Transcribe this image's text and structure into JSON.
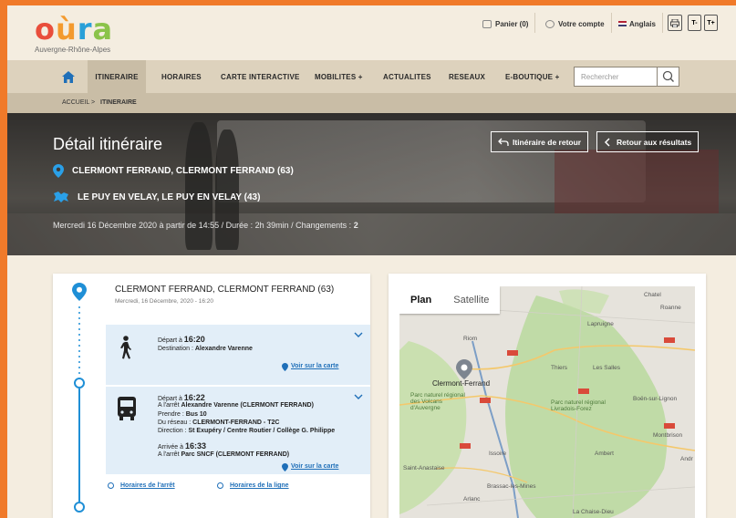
{
  "logo": {
    "letters": [
      "o",
      "ù",
      "r",
      "a"
    ],
    "subtitle": "Auvergne-Rhône-Alpes"
  },
  "utility": {
    "cart": "Panier (0)",
    "account": "Votre compte",
    "language": "Anglais",
    "font_small": "T-",
    "font_large": "T+",
    "icons": [
      "cart-icon",
      "user-icon",
      "flag-uk-icon",
      "print-icon"
    ]
  },
  "nav": {
    "items": [
      "ITINERAIRE",
      "HORAIRES",
      "CARTE INTERACTIVE",
      "MOBILITES +",
      "ACTUALITES",
      "RESEAUX",
      "E-BOUTIQUE +"
    ],
    "active": "ITINERAIRE",
    "search_placeholder": "Rechercher"
  },
  "breadcrumb": {
    "home": "ACCUEIL",
    "separator": ">",
    "current": "ITINERAIRE"
  },
  "hero": {
    "title": "Détail itinéraire",
    "origin": "CLERMONT FERRAND, CLERMONT FERRAND (63)",
    "destination": "LE PUY EN VELAY, LE PUY EN VELAY (43)",
    "meta_prefix": "Mercredi 16 Décembre 2020 à partir de 14:55 / Durée : 2h 39min / Changements : ",
    "changes": "2",
    "return_button": "Itinéraire de retour",
    "back_button": "Retour aux résultats"
  },
  "itinerary": {
    "origin_title": "CLERMONT FERRAND, CLERMONT FERRAND (63)",
    "origin_date": "Mercredi, 16 Décembre, 2020 - 16:20",
    "walk": {
      "depart_label": "Départ à ",
      "depart_time": "16:20",
      "destination_label": "Destination : ",
      "destination": "Alexandre Varenne",
      "map_link": "Voir sur la carte"
    },
    "bus": {
      "depart_label": "Départ à ",
      "depart_time": "16:22",
      "stop_label": "A l'arrêt ",
      "stop": "Alexandre Varenne (CLERMONT FERRAND)",
      "take_label": "Prendre : ",
      "line": "Bus 10",
      "network_label": "Du réseau : ",
      "network": "CLERMONT-FERRAND - T2C",
      "direction_label": "Direction : ",
      "direction": "St Exupéry / Centre Routier / Collège G. Philippe",
      "arrival_label": "Arrivée à ",
      "arrival_time": "16:33",
      "arrival_stop_label": "A l'arrêt ",
      "arrival_stop": "Parc SNCF (CLERMONT FERRAND)",
      "map_link": "Voir sur la carte",
      "stop_hours": "Horaires de l'arrêt",
      "line_hours": "Horaires de la ligne"
    }
  },
  "map": {
    "tabs": [
      "Plan",
      "Satellite"
    ],
    "active_tab": "Plan",
    "place_labels": [
      "Chatel",
      "Roanne",
      "Lapruigne",
      "Riom",
      "Thiers",
      "Les Salles",
      "Clermont-Ferrand",
      "Boën-sur-Lignon",
      "Parc naturel régional des Volcans d'Auvergne",
      "Parc naturel régional Livradois-Forez",
      "Montbrison",
      "Issoire",
      "Ambert",
      "Andr",
      "Saint-Anastaise",
      "Brassac-les-Mines",
      "Arlanc",
      "La Chaise-Dieu"
    ]
  },
  "colors": {
    "accent": "#1f8fd6",
    "brand_orange": "#f07a2a",
    "background": "#f4ede0",
    "nav": "#ddd2bd"
  }
}
